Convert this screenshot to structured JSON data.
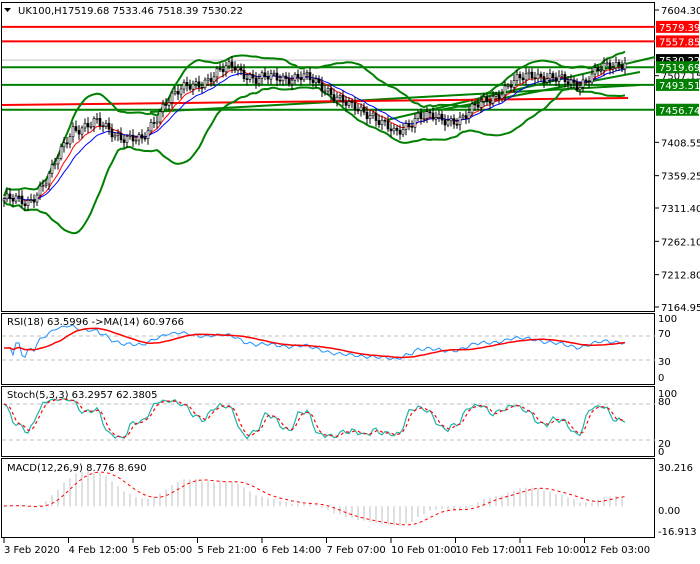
{
  "header": {
    "symbol": "UK100,H1",
    "ohlc": "7519.68 7533.46 7518.39 7530.22"
  },
  "main_axis": {
    "ticks": [
      "7604.30",
      "7507.15",
      "7408.55",
      "7359.25",
      "7311.40",
      "7262.10",
      "7212.80",
      "7164.95"
    ],
    "range": [
      7164.95,
      7604.3
    ]
  },
  "levels": {
    "red": [
      "7579.39",
      "7557.85"
    ],
    "green": [
      "7519.69",
      "7493.51",
      "7456.74"
    ],
    "current": "7530.22"
  },
  "colors": {
    "red_level": "#ff0000",
    "green_level": "#008000",
    "band": "#008000",
    "up_candle": "#000000",
    "current_bg": "#000000",
    "rsi": "#1e90ff",
    "rsi_ma": "#ff0000",
    "stoch_main": "#20b2aa",
    "stoch_signal": "#ff0000",
    "macd_hist": "#c0c0c0",
    "macd_signal": "#ff0000"
  },
  "rsi": {
    "label": "RSI(18) 63.5996  ->MA(14) 60.9766",
    "ticks": [
      "100",
      "70",
      "30",
      "0"
    ]
  },
  "stoch": {
    "label": "Stoch(5,3,3) 63.2957 62.3805",
    "ticks": [
      "100",
      "80",
      "20",
      "0"
    ]
  },
  "macd": {
    "label": "MACD(12,26,9) 8.776 8.690",
    "ticks": [
      "30.216",
      "0.00",
      "-16.913"
    ],
    "range": [
      -16.913,
      30.216
    ]
  },
  "time_axis": [
    "3 Feb 2020",
    "4 Feb 12:00",
    "5 Feb 05:00",
    "5 Feb 21:00",
    "6 Feb 14:00",
    "7 Feb 07:00",
    "10 Feb 01:00",
    "10 Feb 17:00",
    "11 Feb 10:00",
    "12 Feb 03:00"
  ],
  "chart_data": {
    "type": "candlestick",
    "timeframe": "H1",
    "anchor_closes": [
      7325,
      7318,
      7360,
      7430,
      7436,
      7420,
      7408,
      7470,
      7490,
      7505,
      7522,
      7500,
      7506,
      7504,
      7490,
      7460,
      7452,
      7418,
      7450,
      7440,
      7446,
      7472,
      7492,
      7512,
      7500,
      7496,
      7516,
      7530
    ]
  }
}
